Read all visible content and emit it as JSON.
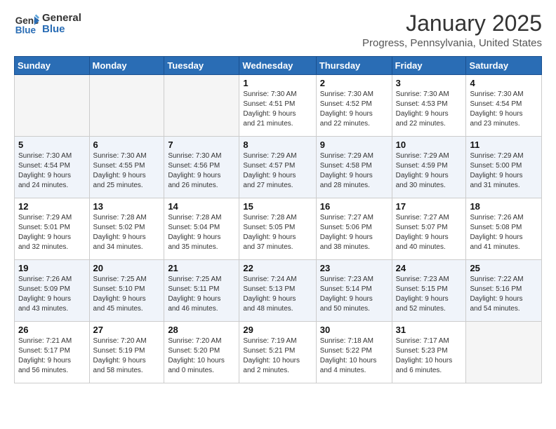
{
  "header": {
    "logo_line1": "General",
    "logo_line2": "Blue",
    "month": "January 2025",
    "location": "Progress, Pennsylvania, United States"
  },
  "weekdays": [
    "Sunday",
    "Monday",
    "Tuesday",
    "Wednesday",
    "Thursday",
    "Friday",
    "Saturday"
  ],
  "weeks": [
    [
      {
        "day": "",
        "info": ""
      },
      {
        "day": "",
        "info": ""
      },
      {
        "day": "",
        "info": ""
      },
      {
        "day": "1",
        "info": "Sunrise: 7:30 AM\nSunset: 4:51 PM\nDaylight: 9 hours\nand 21 minutes."
      },
      {
        "day": "2",
        "info": "Sunrise: 7:30 AM\nSunset: 4:52 PM\nDaylight: 9 hours\nand 22 minutes."
      },
      {
        "day": "3",
        "info": "Sunrise: 7:30 AM\nSunset: 4:53 PM\nDaylight: 9 hours\nand 22 minutes."
      },
      {
        "day": "4",
        "info": "Sunrise: 7:30 AM\nSunset: 4:54 PM\nDaylight: 9 hours\nand 23 minutes."
      }
    ],
    [
      {
        "day": "5",
        "info": "Sunrise: 7:30 AM\nSunset: 4:54 PM\nDaylight: 9 hours\nand 24 minutes."
      },
      {
        "day": "6",
        "info": "Sunrise: 7:30 AM\nSunset: 4:55 PM\nDaylight: 9 hours\nand 25 minutes."
      },
      {
        "day": "7",
        "info": "Sunrise: 7:30 AM\nSunset: 4:56 PM\nDaylight: 9 hours\nand 26 minutes."
      },
      {
        "day": "8",
        "info": "Sunrise: 7:29 AM\nSunset: 4:57 PM\nDaylight: 9 hours\nand 27 minutes."
      },
      {
        "day": "9",
        "info": "Sunrise: 7:29 AM\nSunset: 4:58 PM\nDaylight: 9 hours\nand 28 minutes."
      },
      {
        "day": "10",
        "info": "Sunrise: 7:29 AM\nSunset: 4:59 PM\nDaylight: 9 hours\nand 30 minutes."
      },
      {
        "day": "11",
        "info": "Sunrise: 7:29 AM\nSunset: 5:00 PM\nDaylight: 9 hours\nand 31 minutes."
      }
    ],
    [
      {
        "day": "12",
        "info": "Sunrise: 7:29 AM\nSunset: 5:01 PM\nDaylight: 9 hours\nand 32 minutes."
      },
      {
        "day": "13",
        "info": "Sunrise: 7:28 AM\nSunset: 5:02 PM\nDaylight: 9 hours\nand 34 minutes."
      },
      {
        "day": "14",
        "info": "Sunrise: 7:28 AM\nSunset: 5:04 PM\nDaylight: 9 hours\nand 35 minutes."
      },
      {
        "day": "15",
        "info": "Sunrise: 7:28 AM\nSunset: 5:05 PM\nDaylight: 9 hours\nand 37 minutes."
      },
      {
        "day": "16",
        "info": "Sunrise: 7:27 AM\nSunset: 5:06 PM\nDaylight: 9 hours\nand 38 minutes."
      },
      {
        "day": "17",
        "info": "Sunrise: 7:27 AM\nSunset: 5:07 PM\nDaylight: 9 hours\nand 40 minutes."
      },
      {
        "day": "18",
        "info": "Sunrise: 7:26 AM\nSunset: 5:08 PM\nDaylight: 9 hours\nand 41 minutes."
      }
    ],
    [
      {
        "day": "19",
        "info": "Sunrise: 7:26 AM\nSunset: 5:09 PM\nDaylight: 9 hours\nand 43 minutes."
      },
      {
        "day": "20",
        "info": "Sunrise: 7:25 AM\nSunset: 5:10 PM\nDaylight: 9 hours\nand 45 minutes."
      },
      {
        "day": "21",
        "info": "Sunrise: 7:25 AM\nSunset: 5:11 PM\nDaylight: 9 hours\nand 46 minutes."
      },
      {
        "day": "22",
        "info": "Sunrise: 7:24 AM\nSunset: 5:13 PM\nDaylight: 9 hours\nand 48 minutes."
      },
      {
        "day": "23",
        "info": "Sunrise: 7:23 AM\nSunset: 5:14 PM\nDaylight: 9 hours\nand 50 minutes."
      },
      {
        "day": "24",
        "info": "Sunrise: 7:23 AM\nSunset: 5:15 PM\nDaylight: 9 hours\nand 52 minutes."
      },
      {
        "day": "25",
        "info": "Sunrise: 7:22 AM\nSunset: 5:16 PM\nDaylight: 9 hours\nand 54 minutes."
      }
    ],
    [
      {
        "day": "26",
        "info": "Sunrise: 7:21 AM\nSunset: 5:17 PM\nDaylight: 9 hours\nand 56 minutes."
      },
      {
        "day": "27",
        "info": "Sunrise: 7:20 AM\nSunset: 5:19 PM\nDaylight: 9 hours\nand 58 minutes."
      },
      {
        "day": "28",
        "info": "Sunrise: 7:20 AM\nSunset: 5:20 PM\nDaylight: 10 hours\nand 0 minutes."
      },
      {
        "day": "29",
        "info": "Sunrise: 7:19 AM\nSunset: 5:21 PM\nDaylight: 10 hours\nand 2 minutes."
      },
      {
        "day": "30",
        "info": "Sunrise: 7:18 AM\nSunset: 5:22 PM\nDaylight: 10 hours\nand 4 minutes."
      },
      {
        "day": "31",
        "info": "Sunrise: 7:17 AM\nSunset: 5:23 PM\nDaylight: 10 hours\nand 6 minutes."
      },
      {
        "day": "",
        "info": ""
      }
    ]
  ]
}
